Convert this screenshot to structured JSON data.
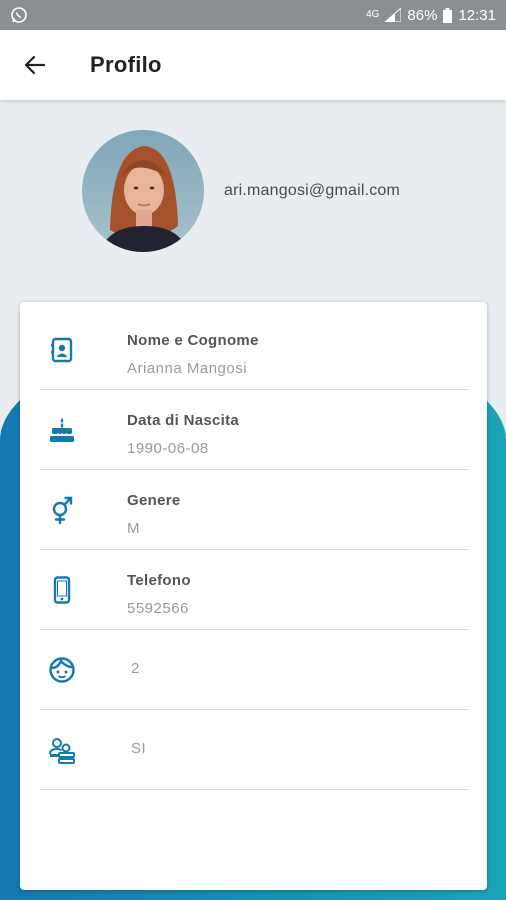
{
  "status_bar": {
    "network": "4G",
    "battery": "86%",
    "time": "12:31"
  },
  "header": {
    "title": "Profilo"
  },
  "profile": {
    "email": "ari.mangosi@gmail.com"
  },
  "fields": [
    {
      "icon": "contact-card-icon",
      "label": "Nome e Cognome",
      "value": "Arianna Mangosi"
    },
    {
      "icon": "birthday-cake-icon",
      "label": "Data di Nascita",
      "value": "1990-06-08"
    },
    {
      "icon": "gender-icon",
      "label": "Genere",
      "value": "M"
    },
    {
      "icon": "phone-icon",
      "label": "Telefono",
      "value": "5592566"
    },
    {
      "icon": "child-face-icon",
      "value": "2"
    },
    {
      "icon": "people-icon",
      "value": "SI"
    }
  ],
  "colors": {
    "accent": "#1479b0",
    "accent_teal": "#1aa4b8",
    "status_bar": "#8b8f92"
  }
}
